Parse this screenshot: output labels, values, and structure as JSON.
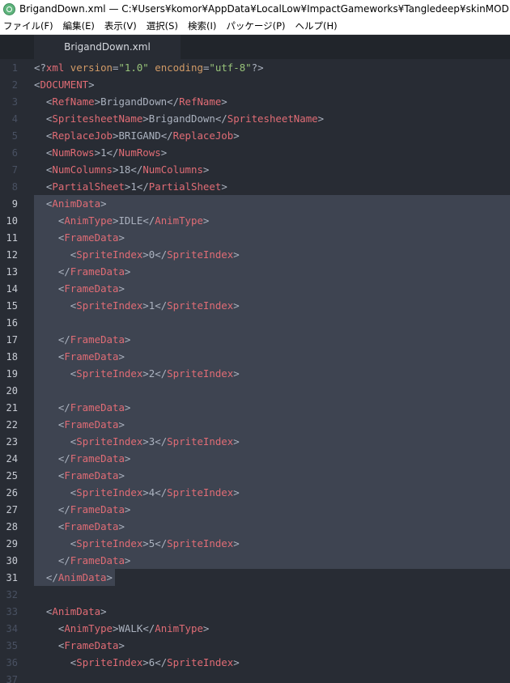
{
  "window": {
    "title": "BrigandDown.xml — C:¥Users¥komor¥AppData¥LocalLow¥ImpactGameworks¥Tangledeep¥skinMOD — Atom"
  },
  "menu": [
    "ファイル(F)",
    "編集(E)",
    "表示(V)",
    "選択(S)",
    "検索(I)",
    "パッケージ(P)",
    "ヘルプ(H)"
  ],
  "tab": {
    "label": "BrigandDown.xml"
  },
  "editor": {
    "selection_start_line": 9,
    "selection_end_line": 31,
    "lines": [
      {
        "n": "1",
        "indent": "",
        "tokens": [
          [
            "punct",
            "<?"
          ],
          [
            "tag",
            "xml"
          ],
          [
            "punct",
            " "
          ],
          [
            "attr",
            "version"
          ],
          [
            "punct",
            "="
          ],
          [
            "str",
            "\"1.0\""
          ],
          [
            "punct",
            " "
          ],
          [
            "attr",
            "encoding"
          ],
          [
            "punct",
            "="
          ],
          [
            "str",
            "\"utf-8\""
          ],
          [
            "punct",
            "?>"
          ]
        ]
      },
      {
        "n": "2",
        "indent": "",
        "tokens": [
          [
            "punct",
            "<"
          ],
          [
            "tag",
            "DOCUMENT"
          ],
          [
            "punct",
            ">"
          ]
        ]
      },
      {
        "n": "3",
        "indent": "  ",
        "tokens": [
          [
            "punct",
            "<"
          ],
          [
            "tag",
            "RefName"
          ],
          [
            "punct",
            ">"
          ],
          [
            "text",
            "BrigandDown"
          ],
          [
            "punct",
            "</"
          ],
          [
            "tag",
            "RefName"
          ],
          [
            "punct",
            ">"
          ]
        ]
      },
      {
        "n": "4",
        "indent": "  ",
        "tokens": [
          [
            "punct",
            "<"
          ],
          [
            "tag",
            "SpritesheetName"
          ],
          [
            "punct",
            ">"
          ],
          [
            "text",
            "BrigandDown"
          ],
          [
            "punct",
            "</"
          ],
          [
            "tag",
            "SpritesheetName"
          ],
          [
            "punct",
            ">"
          ]
        ]
      },
      {
        "n": "5",
        "indent": "  ",
        "tokens": [
          [
            "punct",
            "<"
          ],
          [
            "tag",
            "ReplaceJob"
          ],
          [
            "punct",
            ">"
          ],
          [
            "text",
            "BRIGAND"
          ],
          [
            "punct",
            "</"
          ],
          [
            "tag",
            "ReplaceJob"
          ],
          [
            "punct",
            ">"
          ]
        ]
      },
      {
        "n": "6",
        "indent": "  ",
        "tokens": [
          [
            "punct",
            "<"
          ],
          [
            "tag",
            "NumRows"
          ],
          [
            "punct",
            ">"
          ],
          [
            "text",
            "1"
          ],
          [
            "punct",
            "</"
          ],
          [
            "tag",
            "NumRows"
          ],
          [
            "punct",
            ">"
          ]
        ]
      },
      {
        "n": "7",
        "indent": "  ",
        "tokens": [
          [
            "punct",
            "<"
          ],
          [
            "tag",
            "NumColumns"
          ],
          [
            "punct",
            ">"
          ],
          [
            "text",
            "18"
          ],
          [
            "punct",
            "</"
          ],
          [
            "tag",
            "NumColumns"
          ],
          [
            "punct",
            ">"
          ]
        ]
      },
      {
        "n": "8",
        "indent": "  ",
        "tokens": [
          [
            "punct",
            "<"
          ],
          [
            "tag",
            "PartialSheet"
          ],
          [
            "punct",
            ">"
          ],
          [
            "text",
            "1"
          ],
          [
            "punct",
            "</"
          ],
          [
            "tag",
            "PartialSheet"
          ],
          [
            "punct",
            ">"
          ]
        ]
      },
      {
        "n": "9",
        "indent": "  ",
        "tokens": [
          [
            "punct",
            "<"
          ],
          [
            "tag",
            "AnimData"
          ],
          [
            "punct",
            ">"
          ]
        ]
      },
      {
        "n": "10",
        "indent": "    ",
        "tokens": [
          [
            "punct",
            "<"
          ],
          [
            "tag",
            "AnimType"
          ],
          [
            "punct",
            ">"
          ],
          [
            "text",
            "IDLE"
          ],
          [
            "punct",
            "</"
          ],
          [
            "tag",
            "AnimType"
          ],
          [
            "punct",
            ">"
          ]
        ]
      },
      {
        "n": "11",
        "indent": "    ",
        "tokens": [
          [
            "punct",
            "<"
          ],
          [
            "tag",
            "FrameData"
          ],
          [
            "punct",
            ">"
          ]
        ]
      },
      {
        "n": "12",
        "indent": "      ",
        "tokens": [
          [
            "punct",
            "<"
          ],
          [
            "tag",
            "SpriteIndex"
          ],
          [
            "punct",
            ">"
          ],
          [
            "text",
            "0"
          ],
          [
            "punct",
            "</"
          ],
          [
            "tag",
            "SpriteIndex"
          ],
          [
            "punct",
            ">"
          ]
        ]
      },
      {
        "n": "13",
        "indent": "    ",
        "tokens": [
          [
            "punct",
            "</"
          ],
          [
            "tag",
            "FrameData"
          ],
          [
            "punct",
            ">"
          ]
        ]
      },
      {
        "n": "14",
        "indent": "    ",
        "tokens": [
          [
            "punct",
            "<"
          ],
          [
            "tag",
            "FrameData"
          ],
          [
            "punct",
            ">"
          ]
        ]
      },
      {
        "n": "15",
        "indent": "      ",
        "tokens": [
          [
            "punct",
            "<"
          ],
          [
            "tag",
            "SpriteIndex"
          ],
          [
            "punct",
            ">"
          ],
          [
            "text",
            "1"
          ],
          [
            "punct",
            "</"
          ],
          [
            "tag",
            "SpriteIndex"
          ],
          [
            "punct",
            ">"
          ]
        ]
      },
      {
        "n": "16",
        "indent": "",
        "tokens": []
      },
      {
        "n": "17",
        "indent": "    ",
        "tokens": [
          [
            "punct",
            "</"
          ],
          [
            "tag",
            "FrameData"
          ],
          [
            "punct",
            ">"
          ]
        ]
      },
      {
        "n": "18",
        "indent": "    ",
        "tokens": [
          [
            "punct",
            "<"
          ],
          [
            "tag",
            "FrameData"
          ],
          [
            "punct",
            ">"
          ]
        ]
      },
      {
        "n": "19",
        "indent": "      ",
        "tokens": [
          [
            "punct",
            "<"
          ],
          [
            "tag",
            "SpriteIndex"
          ],
          [
            "punct",
            ">"
          ],
          [
            "text",
            "2"
          ],
          [
            "punct",
            "</"
          ],
          [
            "tag",
            "SpriteIndex"
          ],
          [
            "punct",
            ">"
          ]
        ]
      },
      {
        "n": "20",
        "indent": "",
        "tokens": []
      },
      {
        "n": "21",
        "indent": "    ",
        "tokens": [
          [
            "punct",
            "</"
          ],
          [
            "tag",
            "FrameData"
          ],
          [
            "punct",
            ">"
          ]
        ]
      },
      {
        "n": "22",
        "indent": "    ",
        "tokens": [
          [
            "punct",
            "<"
          ],
          [
            "tag",
            "FrameData"
          ],
          [
            "punct",
            ">"
          ]
        ]
      },
      {
        "n": "23",
        "indent": "      ",
        "tokens": [
          [
            "punct",
            "<"
          ],
          [
            "tag",
            "SpriteIndex"
          ],
          [
            "punct",
            ">"
          ],
          [
            "text",
            "3"
          ],
          [
            "punct",
            "</"
          ],
          [
            "tag",
            "SpriteIndex"
          ],
          [
            "punct",
            ">"
          ]
        ]
      },
      {
        "n": "24",
        "indent": "    ",
        "tokens": [
          [
            "punct",
            "</"
          ],
          [
            "tag",
            "FrameData"
          ],
          [
            "punct",
            ">"
          ]
        ]
      },
      {
        "n": "25",
        "indent": "    ",
        "tokens": [
          [
            "punct",
            "<"
          ],
          [
            "tag",
            "FrameData"
          ],
          [
            "punct",
            ">"
          ]
        ]
      },
      {
        "n": "26",
        "indent": "      ",
        "tokens": [
          [
            "punct",
            "<"
          ],
          [
            "tag",
            "SpriteIndex"
          ],
          [
            "punct",
            ">"
          ],
          [
            "text",
            "4"
          ],
          [
            "punct",
            "</"
          ],
          [
            "tag",
            "SpriteIndex"
          ],
          [
            "punct",
            ">"
          ]
        ]
      },
      {
        "n": "27",
        "indent": "    ",
        "tokens": [
          [
            "punct",
            "</"
          ],
          [
            "tag",
            "FrameData"
          ],
          [
            "punct",
            ">"
          ]
        ]
      },
      {
        "n": "28",
        "indent": "    ",
        "tokens": [
          [
            "punct",
            "<"
          ],
          [
            "tag",
            "FrameData"
          ],
          [
            "punct",
            ">"
          ]
        ]
      },
      {
        "n": "29",
        "indent": "      ",
        "tokens": [
          [
            "punct",
            "<"
          ],
          [
            "tag",
            "SpriteIndex"
          ],
          [
            "punct",
            ">"
          ],
          [
            "text",
            "5"
          ],
          [
            "punct",
            "</"
          ],
          [
            "tag",
            "SpriteIndex"
          ],
          [
            "punct",
            ">"
          ]
        ]
      },
      {
        "n": "30",
        "indent": "    ",
        "tokens": [
          [
            "punct",
            "</"
          ],
          [
            "tag",
            "FrameData"
          ],
          [
            "punct",
            ">"
          ]
        ]
      },
      {
        "n": "31",
        "indent": "  ",
        "tokens": [
          [
            "punct",
            "</"
          ],
          [
            "tag",
            "AnimData"
          ],
          [
            "punct",
            ">"
          ]
        ]
      },
      {
        "n": "32",
        "indent": "",
        "tokens": []
      },
      {
        "n": "33",
        "indent": "  ",
        "tokens": [
          [
            "punct",
            "<"
          ],
          [
            "tag",
            "AnimData"
          ],
          [
            "punct",
            ">"
          ]
        ]
      },
      {
        "n": "34",
        "indent": "    ",
        "tokens": [
          [
            "punct",
            "<"
          ],
          [
            "tag",
            "AnimType"
          ],
          [
            "punct",
            ">"
          ],
          [
            "text",
            "WALK"
          ],
          [
            "punct",
            "</"
          ],
          [
            "tag",
            "AnimType"
          ],
          [
            "punct",
            ">"
          ]
        ]
      },
      {
        "n": "35",
        "indent": "    ",
        "tokens": [
          [
            "punct",
            "<"
          ],
          [
            "tag",
            "FrameData"
          ],
          [
            "punct",
            ">"
          ]
        ]
      },
      {
        "n": "36",
        "indent": "      ",
        "tokens": [
          [
            "punct",
            "<"
          ],
          [
            "tag",
            "SpriteIndex"
          ],
          [
            "punct",
            ">"
          ],
          [
            "text",
            "6"
          ],
          [
            "punct",
            "</"
          ],
          [
            "tag",
            "SpriteIndex"
          ],
          [
            "punct",
            ">"
          ]
        ]
      },
      {
        "n": "37",
        "indent": "",
        "tokens": []
      }
    ]
  }
}
